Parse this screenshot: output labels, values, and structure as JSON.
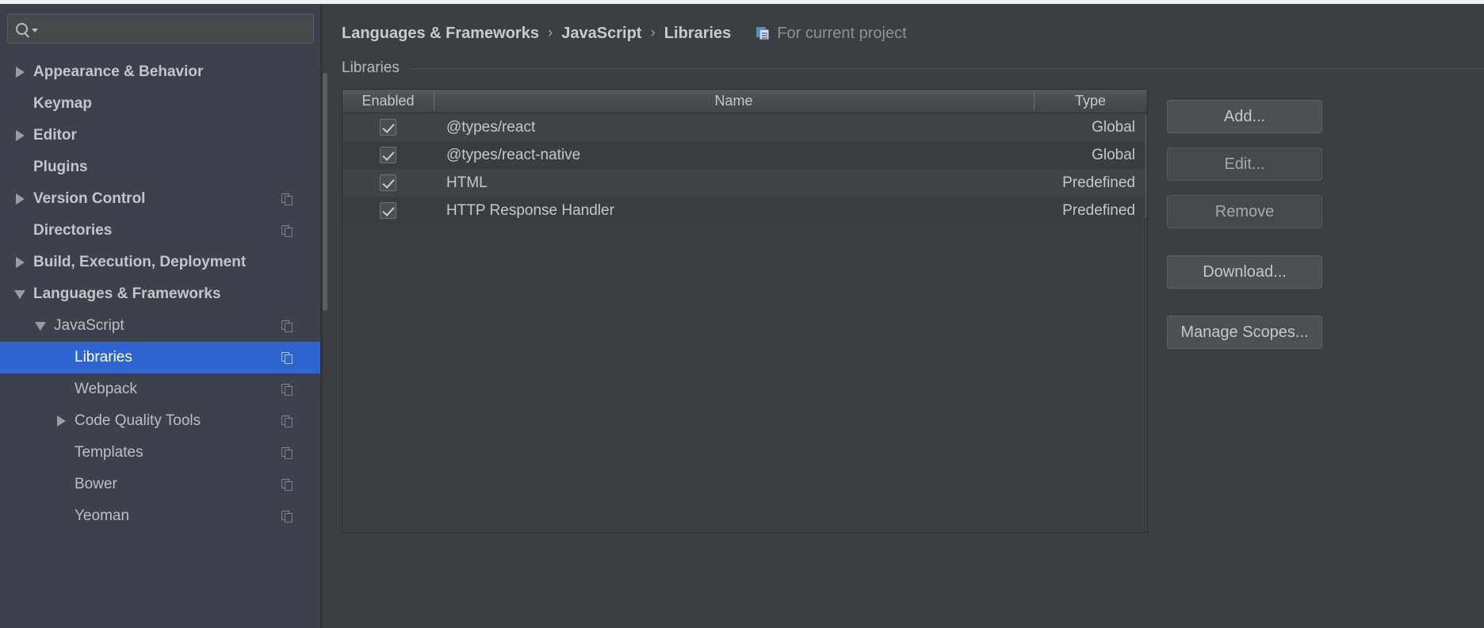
{
  "window": {
    "theme_bg": "#3c3f41",
    "accent": "#2f65d0"
  },
  "search": {
    "placeholder": "",
    "value": "",
    "icon": "search-icon",
    "dropdown_icon": "chevron-down-icon"
  },
  "sidebar": {
    "items": [
      {
        "label": "Appearance & Behavior",
        "arrow": "right",
        "indent": 0,
        "bold": true,
        "copy_icon": false,
        "selected": false
      },
      {
        "label": "Keymap",
        "arrow": "none",
        "indent": 0,
        "bold": true,
        "copy_icon": false,
        "selected": false
      },
      {
        "label": "Editor",
        "arrow": "right",
        "indent": 0,
        "bold": true,
        "copy_icon": false,
        "selected": false
      },
      {
        "label": "Plugins",
        "arrow": "none",
        "indent": 0,
        "bold": true,
        "copy_icon": false,
        "selected": false
      },
      {
        "label": "Version Control",
        "arrow": "right",
        "indent": 0,
        "bold": true,
        "copy_icon": true,
        "selected": false
      },
      {
        "label": "Directories",
        "arrow": "none",
        "indent": 0,
        "bold": true,
        "copy_icon": true,
        "selected": false
      },
      {
        "label": "Build, Execution, Deployment",
        "arrow": "right",
        "indent": 0,
        "bold": true,
        "copy_icon": false,
        "selected": false
      },
      {
        "label": "Languages & Frameworks",
        "arrow": "down",
        "indent": 0,
        "bold": true,
        "copy_icon": false,
        "selected": false
      },
      {
        "label": "JavaScript",
        "arrow": "down",
        "indent": 1,
        "bold": false,
        "copy_icon": true,
        "selected": false
      },
      {
        "label": "Libraries",
        "arrow": "none",
        "indent": 2,
        "bold": false,
        "copy_icon": true,
        "selected": true
      },
      {
        "label": "Webpack",
        "arrow": "none",
        "indent": 2,
        "bold": false,
        "copy_icon": true,
        "selected": false
      },
      {
        "label": "Code Quality Tools",
        "arrow": "right",
        "indent": 2,
        "bold": false,
        "copy_icon": true,
        "selected": false
      },
      {
        "label": "Templates",
        "arrow": "none",
        "indent": 2,
        "bold": false,
        "copy_icon": true,
        "selected": false
      },
      {
        "label": "Bower",
        "arrow": "none",
        "indent": 2,
        "bold": false,
        "copy_icon": true,
        "selected": false
      },
      {
        "label": "Yeoman",
        "arrow": "none",
        "indent": 2,
        "bold": false,
        "copy_icon": true,
        "selected": false
      }
    ]
  },
  "breadcrumb": {
    "separator": "›",
    "crumbs": [
      "Languages & Frameworks",
      "JavaScript",
      "Libraries"
    ],
    "scope": {
      "icon": "project-scope-icon",
      "label": "For current project"
    }
  },
  "main": {
    "section_title": "Libraries",
    "table": {
      "columns": [
        "Enabled",
        "Name",
        "Type"
      ],
      "rows": [
        {
          "enabled": true,
          "name": "@types/react",
          "type": "Global"
        },
        {
          "enabled": true,
          "name": "@types/react-native",
          "type": "Global"
        },
        {
          "enabled": true,
          "name": "HTML",
          "type": "Predefined"
        },
        {
          "enabled": true,
          "name": "HTTP Response Handler",
          "type": "Predefined"
        }
      ]
    },
    "buttons": [
      {
        "label": "Add...",
        "style": "normal"
      },
      {
        "label": "Edit...",
        "style": "flat"
      },
      {
        "label": "Remove",
        "style": "flat"
      },
      {
        "label": "Download...",
        "style": "normal"
      },
      {
        "label": "Manage Scopes...",
        "style": "normal"
      }
    ]
  }
}
